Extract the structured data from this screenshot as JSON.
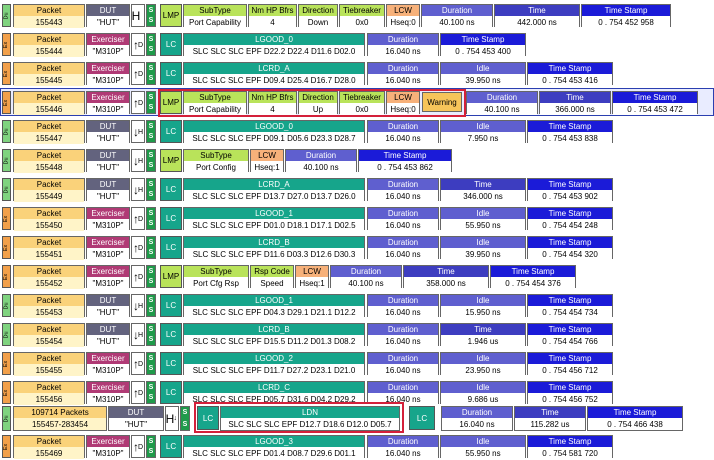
{
  "labels": {
    "packet": "Packet",
    "dut": "DUT",
    "exerciser": "Exerciser",
    "lmp": "LMP",
    "lc": "LC",
    "subtype": "SubType",
    "nmhp": "Nm HP Bfrs",
    "direction": "Direction",
    "tiebreaker": "Tiebreaker",
    "lcw": "LCW",
    "duration": "Duration",
    "time": "Time",
    "timestamp": "Time Stamp",
    "idle": "Idle",
    "rspcode": "Rsp Code",
    "warning": "Warning",
    "ldn": "LDN",
    "side_du": "Du",
    "side_ex": "Ex",
    "S": "S"
  },
  "rows": [
    {
      "packet": "155443",
      "dev": "\"HUT\"",
      "subtype": "Port Capability",
      "nmhp": "4",
      "direction": "Down",
      "tiebreaker": "0x0",
      "lcw": "Hseq:0",
      "duration": "40.100 ns",
      "time": "442.000 ns",
      "ts": "0 . 754 452 958"
    },
    {
      "packet": "155444",
      "dev": "\"M310P\"",
      "sym_name": "LGOOD_0",
      "sym": "SLC SLC SLC EPF D22.2 D22.4 D11.6 D02.0",
      "duration": "16.040 ns",
      "ts": "0 . 754 453 400"
    },
    {
      "packet": "155445",
      "dev": "\"M310P\"",
      "sym_name": "LCRD_A",
      "sym": "SLC SLC SLC EPF D09.4 D25.4 D16.7 D28.0",
      "duration": "16.040 ns",
      "idle": "39.950 ns",
      "ts": "0 . 754 453 416"
    },
    {
      "packet": "155446",
      "dev": "\"M310P\"",
      "subtype": "Port Capability",
      "nmhp": "4",
      "direction": "Up",
      "tiebreaker": "0x0",
      "lcw": "Hseq:0",
      "warning": "Warning",
      "duration": "40.100 ns",
      "time": "366.000 ns",
      "ts": "0 . 754 453 472"
    },
    {
      "packet": "155447",
      "dev": "\"HUT\"",
      "sym_name": "LGOOD_0",
      "sym": "SLC SLC SLC EPF D09.1 D05.6 D23.3 D28.7",
      "duration": "16.040 ns",
      "idle": "7.950 ns",
      "ts": "0 . 754 453 838"
    },
    {
      "packet": "155448",
      "dev": "\"HUT\"",
      "subtype": "Port Config",
      "lcw": "Hseq:1",
      "duration": "40.100 ns",
      "ts": "0 . 754 453 862"
    },
    {
      "packet": "155449",
      "dev": "\"HUT\"",
      "sym_name": "LCRD_A",
      "sym": "SLC SLC SLC EPF D13.7 D27.0 D13.7 D26.0",
      "duration": "16.040 ns",
      "time": "346.000 ns",
      "ts": "0 . 754 453 902"
    },
    {
      "packet": "155450",
      "dev": "\"M310P\"",
      "sym_name": "LGOOD_1",
      "sym": "SLC SLC SLC EPF D01.0 D18.1 D17.1 D02.5",
      "duration": "16.040 ns",
      "idle": "55.950 ns",
      "ts": "0 . 754 454 248"
    },
    {
      "packet": "155451",
      "dev": "\"M310P\"",
      "sym_name": "LCRD_B",
      "sym": "SLC SLC SLC EPF D11.6 D03.3 D12.6 D30.3",
      "duration": "16.040 ns",
      "idle": "39.950 ns",
      "ts": "0 . 754 454 320"
    },
    {
      "packet": "155452",
      "dev": "\"M310P\"",
      "subtype": "Port Cfg Rsp",
      "rspcode": "Speed",
      "lcw": "Hseq:1",
      "duration": "40.100 ns",
      "time": "358.000 ns",
      "ts": "0 . 754 454 376"
    },
    {
      "packet": "155453",
      "dev": "\"HUT\"",
      "sym_name": "LGOOD_1",
      "sym": "SLC SLC SLC EPF D04.3 D29.1 D21.1 D12.2",
      "duration": "16.040 ns",
      "idle": "15.950 ns",
      "ts": "0 . 754 454 734"
    },
    {
      "packet": "155454",
      "dev": "\"HUT\"",
      "sym_name": "LCRD_B",
      "sym": "SLC SLC SLC EPF D15.5 D11.2 D01.3 D08.2",
      "duration": "16.040 ns",
      "time": "1.946 us",
      "ts": "0 . 754 454 766"
    },
    {
      "packet": "155455",
      "dev": "\"M310P\"",
      "sym_name": "LGOOD_2",
      "sym": "SLC SLC SLC EPF D11.7 D27.2 D23.1 D21.0",
      "duration": "16.040 ns",
      "idle": "23.950 ns",
      "ts": "0 . 754 456 712"
    },
    {
      "packet": "155456",
      "dev": "\"M310P\"",
      "sym_name": "LCRD_C",
      "sym": "SLC SLC SLC EPF D05.7 D31.6 D04.2 D29.2",
      "duration": "16.040 ns",
      "idle": "9.686 us",
      "ts": "0 . 754 456 752"
    },
    {
      "packet": "109714 Packets",
      "packet2": "155457-283454",
      "dev": "\"HUT\"",
      "sym": "SLC SLC SLC EPF D12.7 D18.6 D12.0 D05.7",
      "duration": "16.040 ns",
      "time": "115.282 us",
      "ts": "0 . 754 466 438"
    },
    {
      "packet": "155469",
      "dev": "\"M310P\"",
      "sym_name": "LGOOD_3",
      "sym": "SLC SLC SLC EPF D01.4 D08.7 D29.6 D01.1",
      "duration": "16.040 ns",
      "idle": "55.950 ns",
      "ts": "0 . 754 581 720"
    }
  ]
}
